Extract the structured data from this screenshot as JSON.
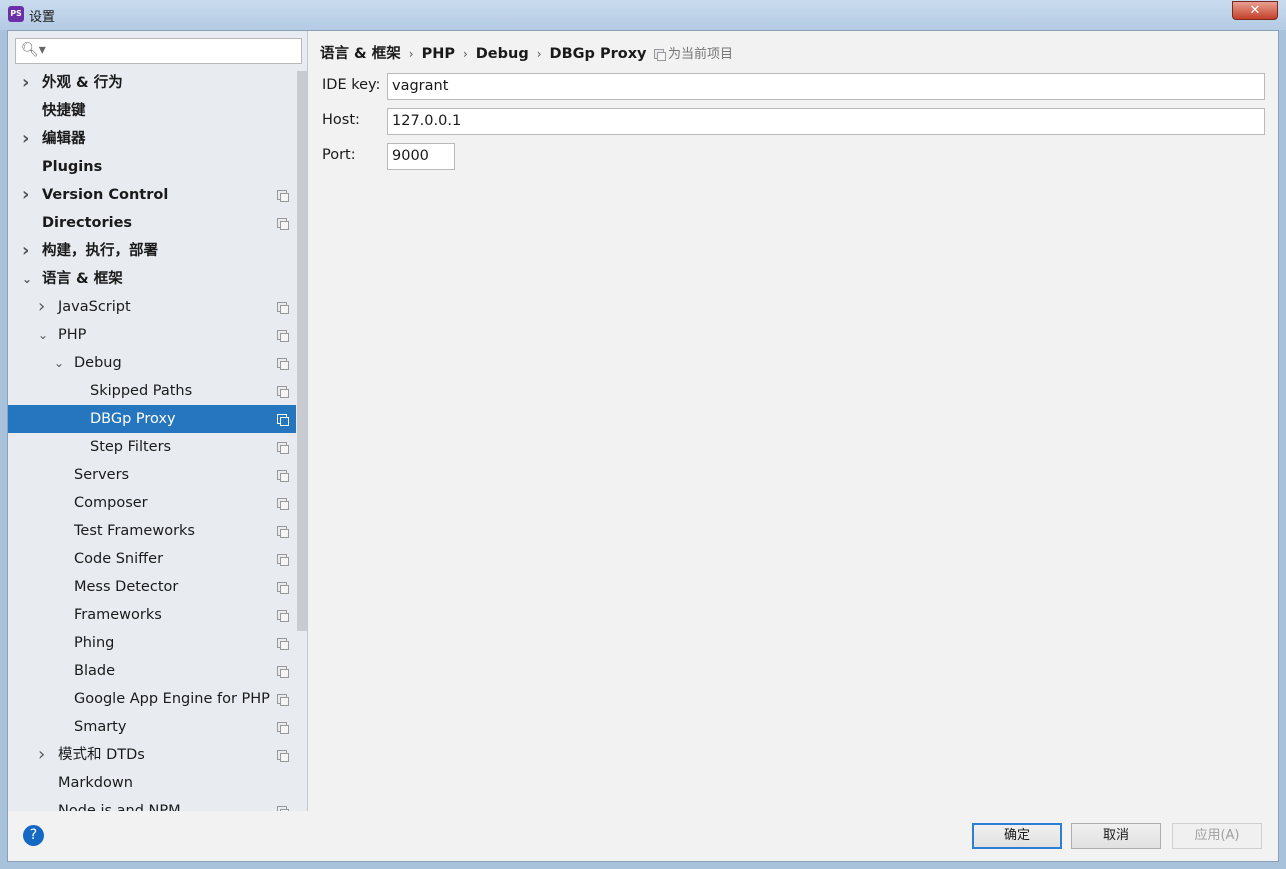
{
  "window": {
    "title": "设置",
    "app_icon": "PS",
    "close": "✕"
  },
  "search": {
    "placeholder": "",
    "icon": "search-icon"
  },
  "tree": [
    {
      "label": "外观 & 行为",
      "level": 0,
      "bold": true,
      "arrow": "right",
      "copy": false
    },
    {
      "label": "快捷键",
      "level": 0,
      "bold": true,
      "arrow": "",
      "copy": false
    },
    {
      "label": "编辑器",
      "level": 0,
      "bold": true,
      "arrow": "right",
      "copy": false
    },
    {
      "label": "Plugins",
      "level": 0,
      "bold": true,
      "arrow": "",
      "copy": false
    },
    {
      "label": "Version Control",
      "level": 0,
      "bold": true,
      "arrow": "right",
      "copy": true
    },
    {
      "label": "Directories",
      "level": 0,
      "bold": true,
      "arrow": "",
      "copy": true
    },
    {
      "label": "构建，执行，部署",
      "level": 0,
      "bold": true,
      "arrow": "right",
      "copy": false
    },
    {
      "label": "语言 & 框架",
      "level": 0,
      "bold": true,
      "arrow": "down",
      "copy": false
    },
    {
      "label": "JavaScript",
      "level": 1,
      "arrow": "right",
      "copy": true
    },
    {
      "label": "PHP",
      "level": 1,
      "arrow": "down",
      "copy": true
    },
    {
      "label": "Debug",
      "level": 2,
      "arrow": "down",
      "copy": true
    },
    {
      "label": "Skipped Paths",
      "level": 3,
      "arrow": "",
      "copy": true
    },
    {
      "label": "DBGp Proxy",
      "level": 3,
      "arrow": "",
      "copy": true,
      "selected": true
    },
    {
      "label": "Step Filters",
      "level": 3,
      "arrow": "",
      "copy": true
    },
    {
      "label": "Servers",
      "level": 2,
      "arrow": "",
      "copy": true
    },
    {
      "label": "Composer",
      "level": 2,
      "arrow": "",
      "copy": true
    },
    {
      "label": "Test Frameworks",
      "level": 2,
      "arrow": "",
      "copy": true
    },
    {
      "label": "Code Sniffer",
      "level": 2,
      "arrow": "",
      "copy": true
    },
    {
      "label": "Mess Detector",
      "level": 2,
      "arrow": "",
      "copy": true
    },
    {
      "label": "Frameworks",
      "level": 2,
      "arrow": "",
      "copy": true
    },
    {
      "label": "Phing",
      "level": 2,
      "arrow": "",
      "copy": true
    },
    {
      "label": "Blade",
      "level": 2,
      "arrow": "",
      "copy": true
    },
    {
      "label": "Google App Engine for PHP",
      "level": 2,
      "arrow": "",
      "copy": true
    },
    {
      "label": "Smarty",
      "level": 2,
      "arrow": "",
      "copy": true
    },
    {
      "label": "模式和 DTDs",
      "level": 1,
      "arrow": "right",
      "copy": true
    },
    {
      "label": "Markdown",
      "level": 1,
      "arrow": "",
      "copy": false
    },
    {
      "label": "Node.js and NPM",
      "level": 1,
      "arrow": "",
      "copy": true
    }
  ],
  "breadcrumb": [
    "语言 & 框架",
    "PHP",
    "Debug",
    "DBGp Proxy"
  ],
  "breadcrumb_sep": "›",
  "project_scope": "为当前项目",
  "form": {
    "ide_key_label": "IDE key:",
    "ide_key": "vagrant",
    "host_label": "Host:",
    "host": "127.0.0.1",
    "port_label": "Port:",
    "port": "9000"
  },
  "buttons": {
    "help": "?",
    "ok": "确定",
    "cancel": "取消",
    "apply": "应用(A)"
  },
  "colors": {
    "selection": "#2675bf",
    "help": "#1669c3"
  }
}
